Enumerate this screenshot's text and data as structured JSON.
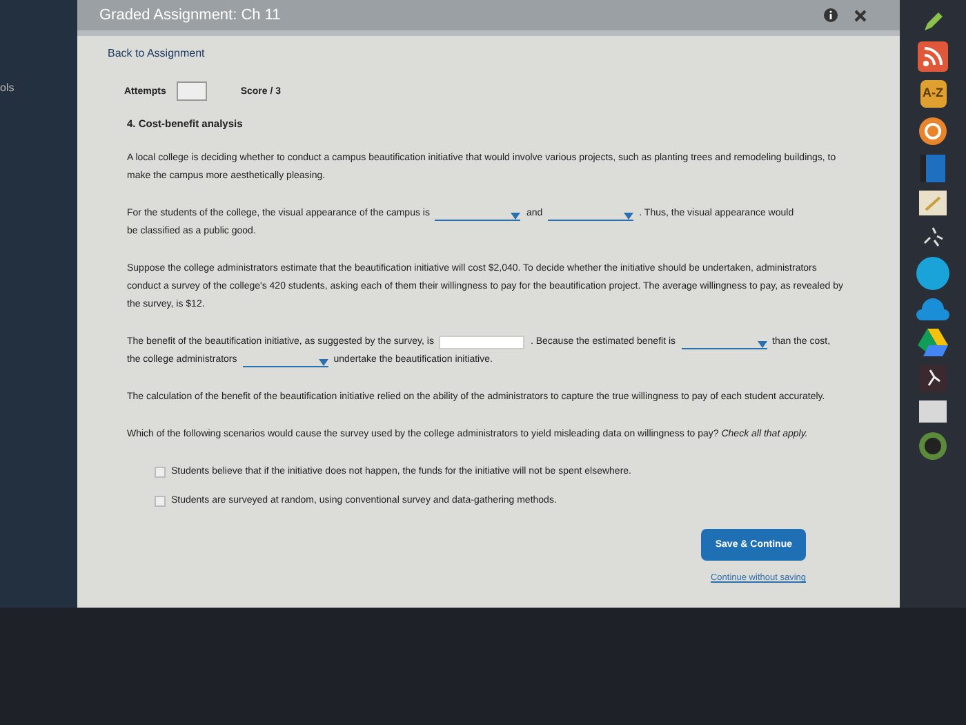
{
  "window": {
    "title": "Graded Assignment: Ch 11"
  },
  "left_rail": {
    "label": "ols"
  },
  "back_link": "Back to Assignment",
  "attempts": {
    "label": "Attempts"
  },
  "score": "Score / 3",
  "question": {
    "title": "4. Cost-benefit analysis",
    "blocks": [
      {
        "kind": "para",
        "text": "A local college is deciding whether to conduct a campus beautification initiative that would involve various projects, such as planting trees and remodeling buildings, to make the campus more aesthetically pleasing."
      },
      {
        "kind": "fill",
        "parts": [
          {
            "kind": "text",
            "text": "For the students of the college, the visual appearance of the campus is"
          },
          {
            "kind": "dropdown"
          },
          {
            "kind": "text",
            "text": "and"
          },
          {
            "kind": "dropdown"
          },
          {
            "kind": "text",
            "text": ". Thus, the visual appearance would"
          },
          {
            "kind": "break"
          },
          {
            "kind": "text",
            "text": "be classified as a public good."
          }
        ]
      },
      {
        "kind": "para",
        "text": "Suppose the college administrators estimate that the beautification initiative will cost $2,040. To decide whether the initiative should be undertaken, administrators conduct a survey of the college's 420 students, asking each of them their willingness to pay for the beautification project. The average willingness to pay, as revealed by the survey, is $12."
      },
      {
        "kind": "fill",
        "parts": [
          {
            "kind": "text",
            "text": "The benefit of the beautification initiative, as suggested by the survey, is"
          },
          {
            "kind": "input"
          },
          {
            "kind": "text",
            "text": ". Because the estimated benefit is"
          },
          {
            "kind": "dropdown"
          },
          {
            "kind": "text",
            "text": "than the cost,"
          },
          {
            "kind": "break"
          },
          {
            "kind": "text",
            "text": "the college administrators"
          },
          {
            "kind": "dropdown"
          },
          {
            "kind": "text",
            "text": "undertake the beautification initiative."
          }
        ]
      },
      {
        "kind": "para",
        "text": "The calculation of the benefit of the beautification initiative relied on the ability of the administrators to capture the true willingness to pay of each student accurately."
      },
      {
        "kind": "para",
        "text": "Which of the following scenarios would cause the survey used by the college administrators to yield misleading data on willingness to pay? *Check all that apply.*"
      }
    ],
    "options": [
      {
        "text": "Students believe that if the initiative does not happen, the funds for the initiative will not be spent elsewhere.",
        "checked": false
      },
      {
        "text": "Students are surveyed at random, using conventional survey and data-gathering methods.",
        "checked": false
      }
    ]
  },
  "save_button": "Save & Continue",
  "continue_link": "Continue without saving",
  "dock": [
    {
      "kind": "pencil"
    },
    {
      "kind": "rss"
    },
    {
      "kind": "label",
      "text": "A-Z"
    },
    {
      "kind": "ring"
    },
    {
      "kind": "book"
    },
    {
      "kind": "note"
    },
    {
      "kind": "sparkle"
    },
    {
      "kind": "circle"
    },
    {
      "kind": "cloud"
    },
    {
      "kind": "triangle"
    },
    {
      "kind": "runner"
    },
    {
      "kind": "card"
    },
    {
      "kind": "profile"
    }
  ]
}
